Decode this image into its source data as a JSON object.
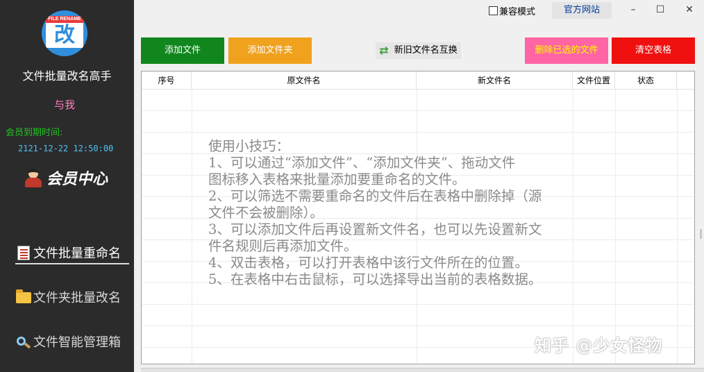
{
  "sidebar": {
    "logo_tag": "FILE RENAME",
    "logo_glyph": "改",
    "app_title": "文件批量改名高手",
    "username": "与我",
    "expire_label": "会员到期时间:",
    "expire_value": "2121-12-22 12:50:00",
    "member_center": "会员中心",
    "nav": [
      {
        "label": "文件批量重命名",
        "icon": "document-icon",
        "active": true
      },
      {
        "label": "文件夹批量改名",
        "icon": "folder-icon",
        "active": false
      },
      {
        "label": "文件智能管理箱",
        "icon": "magnifier-tool-icon",
        "active": false
      }
    ]
  },
  "titlebar": {
    "compat_mode": "兼容模式",
    "compat_checked": false,
    "official_site": "官方网站",
    "minimize": "–",
    "maximize": "☐",
    "close": "✕"
  },
  "toolbar": {
    "add_file": "添加文件",
    "add_folder": "添加文件夹",
    "swap_names": "新旧文件名互换",
    "delete_selected": "删除已选的文件",
    "clear_table": "清空表格"
  },
  "table": {
    "columns": [
      "序号",
      "原文件名",
      "新文件名",
      "文件位置",
      "状态"
    ],
    "tips": [
      "使用小技巧：",
      "1、可以通过“添加文件”、“添加文件夹”、拖动文件",
      "图标移入表格来批量添加要重命名的文件。",
      "2、可以筛选不需要重命名的文件后在表格中删除掉（源",
      "文件不会被删除）。",
      "3、可以添加文件后再设置新文件名，也可以先设置新文",
      "件名规则后再添加文件。",
      "4、双击表格，可以打开表格中该行文件所在的位置。",
      "5、在表格中右击鼠标，可以选择导出当前的表格数据。"
    ]
  },
  "watermark": "知乎 @少女怪物",
  "colors": {
    "sidebar_bg": "#2b2b2b",
    "add_file_bg": "#11861d",
    "add_folder_bg": "#f0a21e",
    "delete_bg": "#ff64a4",
    "clear_bg": "#f01010"
  }
}
